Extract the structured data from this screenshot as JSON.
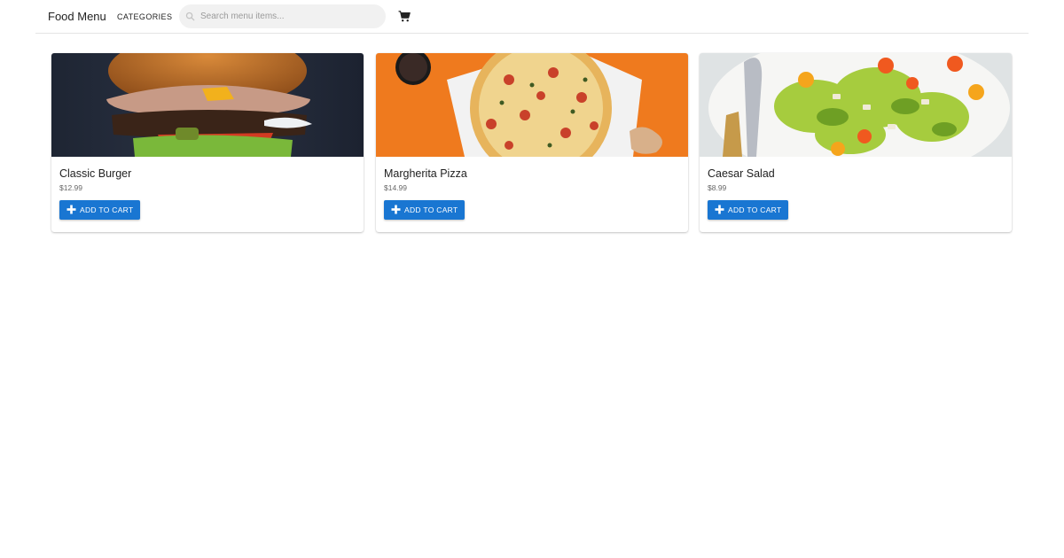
{
  "header": {
    "title": "Food Menu",
    "categories_label": "CATEGORIES",
    "search_placeholder": "Search menu items...",
    "search_value": ""
  },
  "menu": {
    "items": [
      {
        "name": "Classic Burger",
        "price": "$12.99",
        "button_label": "ADD TO CART"
      },
      {
        "name": "Margherita Pizza",
        "price": "$14.99",
        "button_label": "ADD TO CART"
      },
      {
        "name": "Caesar Salad",
        "price": "$8.99",
        "button_label": "ADD TO CART"
      }
    ]
  },
  "icons": {
    "search": "search-icon",
    "cart": "shopping-cart-icon",
    "add": "plus-icon"
  },
  "colors": {
    "primary": "#1976d2",
    "search_bg": "#f1f1f1"
  }
}
